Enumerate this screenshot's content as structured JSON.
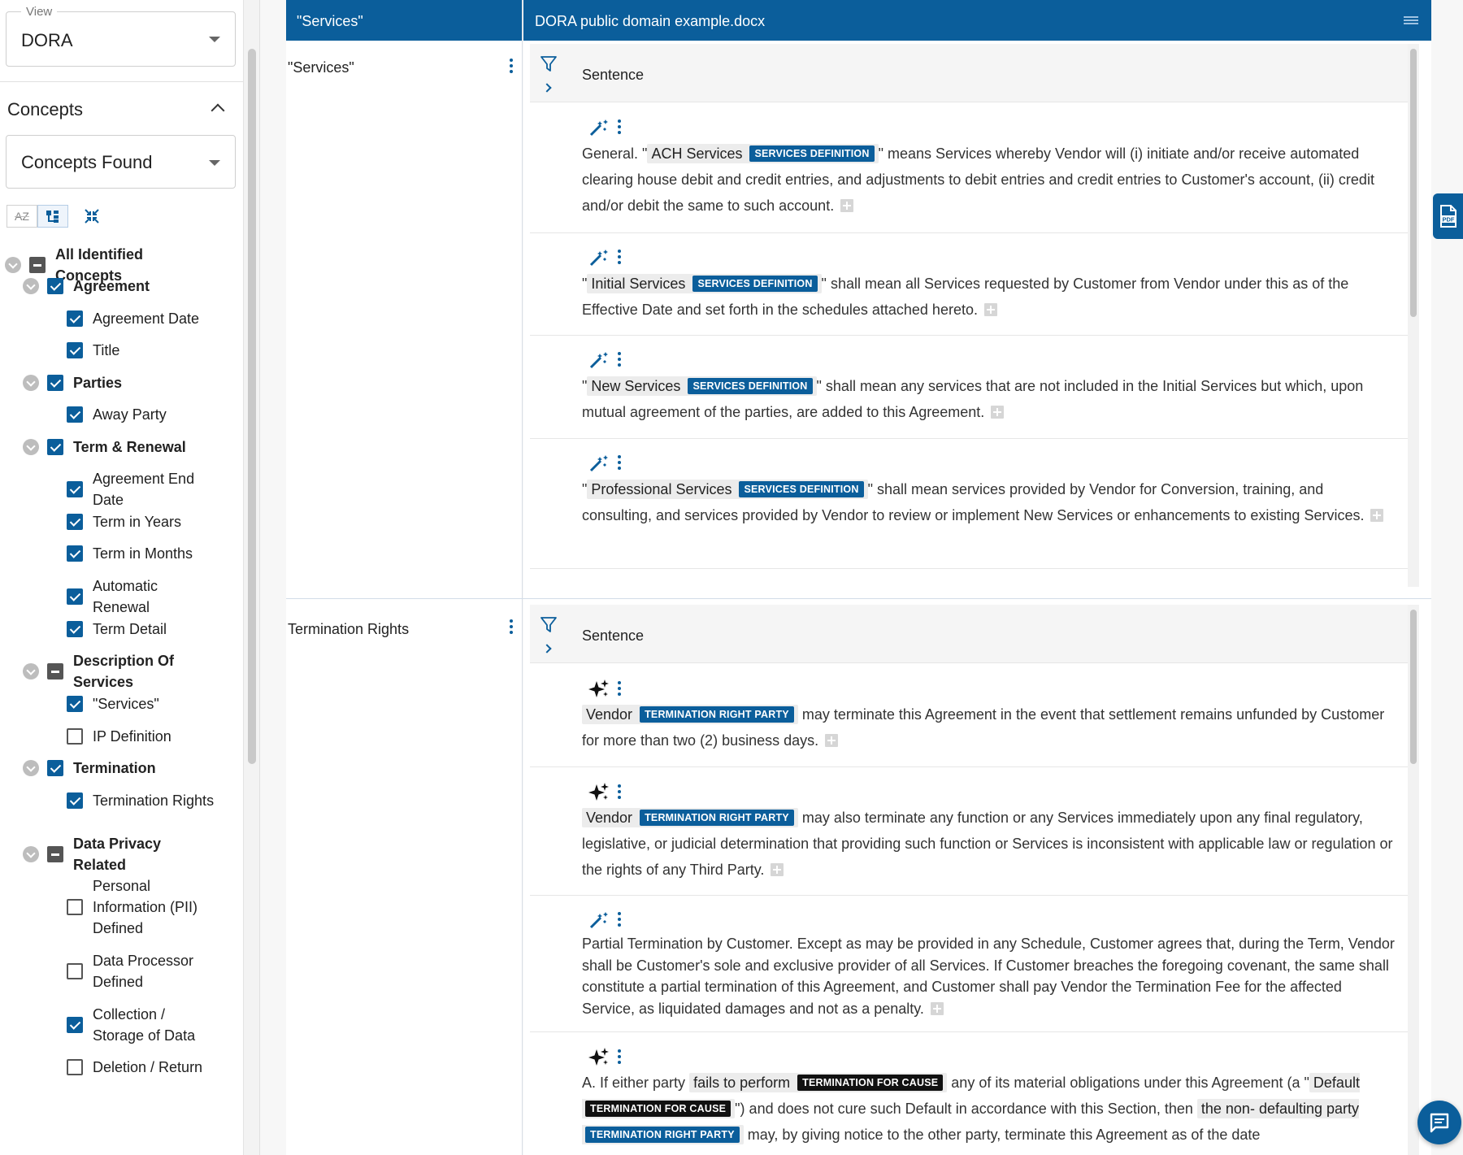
{
  "view": {
    "legend": "View",
    "value": "DORA"
  },
  "concepts": {
    "title": "Concepts",
    "dropdown_value": "Concepts Found",
    "sort_az_label": "AZ",
    "tree": [
      {
        "label": "All Identified Concepts",
        "state": "partial",
        "level": 0
      },
      {
        "label": "Agreement",
        "state": "checked",
        "level": 1
      },
      {
        "label": "Agreement Date",
        "state": "checked",
        "level": 2
      },
      {
        "label": "Title",
        "state": "checked",
        "level": 2
      },
      {
        "label": "Parties",
        "state": "checked",
        "level": 1
      },
      {
        "label": "Away Party",
        "state": "checked",
        "level": 2
      },
      {
        "label": "Term & Renewal",
        "state": "checked",
        "level": 1
      },
      {
        "label": "Agreement End Date",
        "state": "checked",
        "level": 2
      },
      {
        "label": "Term in Years",
        "state": "checked",
        "level": 2
      },
      {
        "label": "Term in Months",
        "state": "checked",
        "level": 2
      },
      {
        "label": "Automatic Renewal",
        "state": "checked",
        "level": 2
      },
      {
        "label": "Term Detail",
        "state": "checked",
        "level": 2
      },
      {
        "label": "Description Of Services",
        "state": "partial",
        "level": 1
      },
      {
        "label": "\"Services\"",
        "state": "checked",
        "level": 2
      },
      {
        "label": "IP Definition",
        "state": "unchecked",
        "level": 2
      },
      {
        "label": "Termination",
        "state": "checked",
        "level": 1
      },
      {
        "label": "Termination Rights",
        "state": "checked",
        "level": 2
      },
      {
        "label": "Data Privacy Related",
        "state": "partial",
        "level": 1
      },
      {
        "label": "Personal Information (PII) Defined",
        "state": "unchecked",
        "level": 2
      },
      {
        "label": "Data Processor Defined",
        "state": "unchecked",
        "level": 2
      },
      {
        "label": "Collection / Storage of Data",
        "state": "checked",
        "level": 2
      },
      {
        "label": "Deletion / Return",
        "state": "unchecked",
        "level": 2
      }
    ]
  },
  "header": {
    "concept_column": "\"Services\"",
    "document_title": "DORA public domain example.docx"
  },
  "rows": [
    {
      "concept": "\"Services\"",
      "column_label": "Sentence",
      "items": [
        {
          "pre": "General. \"",
          "term": "ACH Services",
          "tag": "SERVICES DEFINITION",
          "post": "\" means Services whereby Vendor will (i) initiate and/or receive automated clearing house debit and credit entries, and adjustments to debit entries and credit entries to Customer's account, (ii) credit and/or debit the same to such account."
        },
        {
          "pre": "\"",
          "term": "Initial Services",
          "tag": "SERVICES DEFINITION",
          "post": "\" shall mean all Services requested by Customer from Vendor under this as of the Effective Date and set forth in the schedules attached hereto."
        },
        {
          "pre": "\"",
          "term": "New Services",
          "tag": "SERVICES DEFINITION",
          "post": "\" shall mean any services that are not included in the Initial Services but which, upon mutual agreement of the parties, are added to this Agreement."
        },
        {
          "pre": "\"",
          "term": "Professional Services",
          "tag": "SERVICES DEFINITION",
          "post": "\" shall mean services provided by Vendor for Conversion, training, and consulting, and services provided by Vendor to review or implement New Services or enhancements to existing Services."
        }
      ]
    },
    {
      "concept": "Termination Rights",
      "column_label": "Sentence",
      "items": [
        {
          "term": "Vendor",
          "tag": "TERMINATION RIGHT PARTY",
          "post": " may terminate this Agreement in the event that settlement remains unfunded by Customer for more than two (2) business days."
        },
        {
          "term": "Vendor",
          "tag": "TERMINATION RIGHT PARTY",
          "post": " may also terminate any function or any Services immediately upon any final regulatory, legislative, or judicial determination that providing such function or Services is inconsistent with applicable law or regulation or the rights of any Third Party."
        },
        {
          "text": "Partial Termination by Customer. Except as may be provided in any Schedule, Customer agrees that, during the Term, Vendor shall be Customer's sole and exclusive provider of all Services. If Customer breaches the foregoing covenant, the same shall constitute a partial termination of this Agreement, and Customer shall pay Vendor the Termination Fee for the affected Service, as liquidated damages and not as a penalty."
        },
        {
          "p1": "A. If either party ",
          "term1": "fails to perform",
          "tag1": "TERMINATION FOR CAUSE",
          "p2": " any of its material obligations under this Agreement (a \"",
          "term2": "Default",
          "tag2": "TERMINATION FOR CAUSE",
          "p3": "\") and does not cure such Default in accordance with this Section, then ",
          "term3a": "the non-",
          "term3b": "defaulting party",
          "tag3": "TERMINATION RIGHT PARTY",
          "p4": " may, by giving notice to the other party, terminate this Agreement as of the date"
        }
      ]
    }
  ],
  "icons": {
    "sort_alpha": "sort-az-icon",
    "hierarchy": "hierarchy-icon",
    "collapse": "collapse-all-icon",
    "filter": "filter-icon",
    "wand": "magic-wand-icon",
    "sparkle": "ai-sparkle-icon",
    "pdf": "pdf-icon",
    "chat": "chat-icon"
  },
  "colors": {
    "brand": "#0b5e9b",
    "dark_tag": "#111111"
  }
}
